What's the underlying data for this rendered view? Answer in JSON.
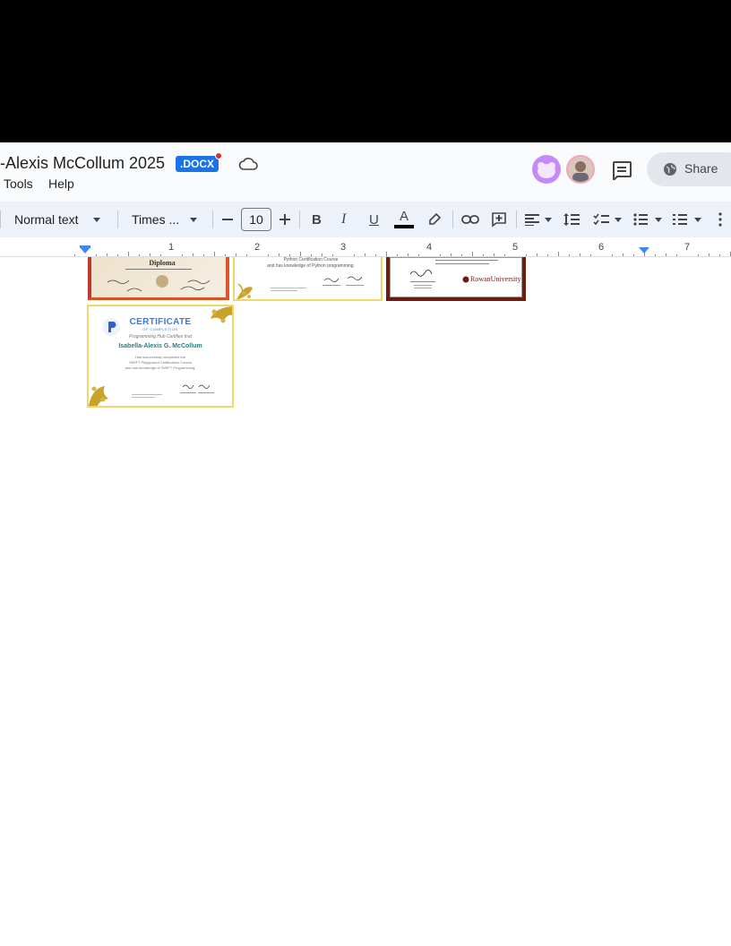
{
  "document": {
    "title": "-Alexis McCollum 2025",
    "format_badge": ".DOCX"
  },
  "menu": {
    "items": [
      "Tools",
      "Help"
    ]
  },
  "share": {
    "label": "Share"
  },
  "toolbar": {
    "style_select": "Normal text",
    "font_select": "Times ...",
    "font_size": "10",
    "bold": "B",
    "italic": "I",
    "underline": "U",
    "text_color_glyph": "A"
  },
  "ruler": {
    "numbers": [
      "1",
      "2",
      "3",
      "4",
      "5",
      "6",
      "7"
    ]
  },
  "certificates": {
    "diploma": {
      "title": "Diploma"
    },
    "python": {
      "line1": "Python Certification Course",
      "line2": "and has knowledge of Python programming."
    },
    "rowan": {
      "university": "RowanUniversity"
    },
    "main": {
      "heading": "CERTIFICATE",
      "subheading": "OF COMPLETION",
      "subtitle": "Programming Hub Certifies that",
      "name": "Isabella-Alexis G. McCollum",
      "body1": "Has successfully completed the",
      "body2": "SWIFT Playground Certification Course",
      "body3": "and has knowledge of SWIFT Programming."
    }
  },
  "colors": {
    "accent_blue": "#1a73e8",
    "cert_gold": "#c9a227",
    "cert_blue": "#3a7bd5",
    "rowan_red": "#6b1d12"
  }
}
